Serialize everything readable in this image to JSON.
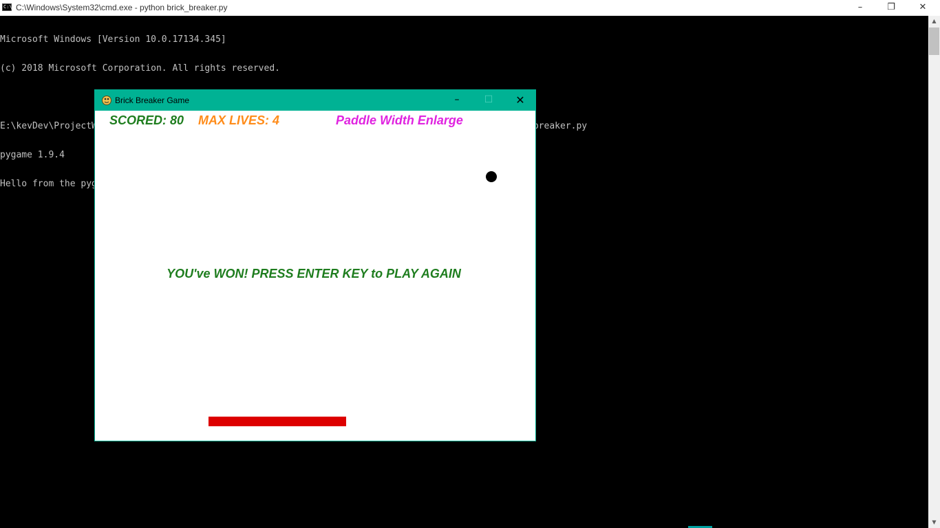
{
  "cmd_window": {
    "title": "C:\\Windows\\System32\\cmd.exe - python  brick_breaker.py",
    "icon": "console-icon",
    "controls": {
      "minimize": "–",
      "maximize": "❐",
      "close": "✕"
    }
  },
  "console": {
    "lines": [
      "Microsoft Windows [Version 10.0.17134.345]",
      "(c) 2018 Microsoft Corporation. All rights reserved.",
      "",
      "E:\\kevDev\\ProjectWorks\\GameDesignProgramming\\GamesDesigned\\BricksVsDefender\\Code\\MVP1>python brick_breaker.py",
      "pygame 1.9.4",
      "Hello from the pygame community. https://www.pygame.org/contribute.html"
    ]
  },
  "game_window": {
    "title": "Brick Breaker Game",
    "icon": "pygame-snake-icon",
    "controls": {
      "minimize": "–",
      "maximize": "☐",
      "close": "✕"
    },
    "hud": {
      "score": "SCORED: 80",
      "lives": "MAX LIVES: 4",
      "powerup": "Paddle Width Enlarge"
    },
    "message": "YOU've WON! PRESS ENTER KEY to PLAY AGAIN",
    "colors": {
      "titlebar": "#00b294",
      "score": "#1e7d1e",
      "lives": "#ff8c1a",
      "powerup": "#e024e0",
      "message": "#1e7d1e",
      "paddle": "#dd0000",
      "ball": "#000000"
    }
  }
}
